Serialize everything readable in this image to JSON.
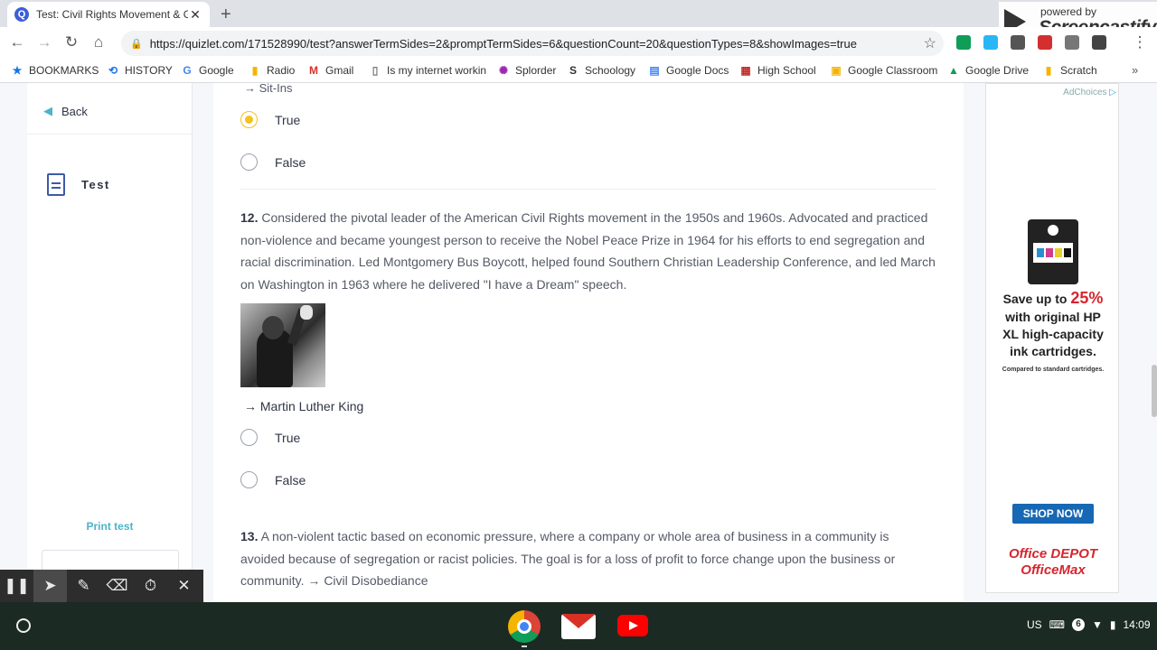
{
  "browser": {
    "tab_title": "Test: Civil Rights Movement & Gr",
    "tab_favicon": "Q",
    "url": "https://quizlet.com/171528990/test?answerTermSides=2&promptTermSides=6&questionCount=20&questionTypes=8&showImages=true",
    "bookmarks": [
      {
        "label": "BOOKMARKS",
        "icon": "star-icon",
        "color": "#1a73e8",
        "glyph": "★"
      },
      {
        "label": "HISTORY",
        "icon": "history-icon",
        "color": "#1a73e8",
        "glyph": "⟲"
      },
      {
        "label": "Google",
        "icon": "google-icon",
        "color": "#4285f4",
        "glyph": "G"
      },
      {
        "label": "Radio",
        "icon": "bookmark-icon",
        "color": "#f4b400",
        "glyph": "▮"
      },
      {
        "label": "Gmail",
        "icon": "gmail-icon",
        "color": "#d93025",
        "glyph": "M"
      },
      {
        "label": "Is my internet workin",
        "icon": "page-icon",
        "color": "#777777",
        "glyph": "▯"
      },
      {
        "label": "Splorder",
        "icon": "splorder-icon",
        "color": "#9c27b0",
        "glyph": "✺"
      },
      {
        "label": "Schoology",
        "icon": "schoology-icon",
        "color": "#333333",
        "glyph": "S"
      },
      {
        "label": "Google Docs",
        "icon": "docs-icon",
        "color": "#4285f4",
        "glyph": "▤"
      },
      {
        "label": "High School",
        "icon": "school-icon",
        "color": "#c62828",
        "glyph": "▦"
      },
      {
        "label": "Google Classroom",
        "icon": "classroom-icon",
        "color": "#f4b400",
        "glyph": "▣"
      },
      {
        "label": "Google Drive",
        "icon": "drive-icon",
        "color": "#0f9d58",
        "glyph": "▲"
      },
      {
        "label": "Scratch",
        "icon": "bookmark-icon",
        "color": "#f4b400",
        "glyph": "▮"
      }
    ],
    "more": "»"
  },
  "screencastify": {
    "small": "powered by",
    "big": "Screencastify"
  },
  "sidebar": {
    "back_label": "Back",
    "test_label": "Test",
    "print_label": "Print test"
  },
  "quiz": {
    "prev_answer": "→ Sit-Ins",
    "q11_options": [
      {
        "label": "True",
        "selected": true
      },
      {
        "label": "False",
        "selected": false
      }
    ],
    "q12": {
      "number": "12.",
      "text": "Considered the pivotal leader of the American Civil Rights movement in the 1950s and 1960s. Advocated and practiced non-violence and became youngest person to receive the Nobel Peace Prize in 1964 for his efforts to end segregation and racial discrimination. Led Montgomery Bus Boycott, helped found Southern Christian Leadership Conference, and led March on Washington in 1963 where he delivered \"I have a Dream\" speech.",
      "answer": "→ Martin Luther King",
      "options": [
        {
          "label": "True",
          "selected": false
        },
        {
          "label": "False",
          "selected": false
        }
      ]
    },
    "q13": {
      "number": "13.",
      "text": "A non-violent tactic based on economic pressure, where a company or whole area of business in a community is avoided because of segregation or racist policies. The goal is for a loss of profit to force change upon the business or community. → Civil Disobediance"
    }
  },
  "ad": {
    "adchoices": "AdChoices",
    "save_prefix": "Save up to",
    "save_pct": "25%",
    "line1": "with original HP",
    "line2": "XL high-capacity",
    "line3": "ink cartridges.",
    "small": "Compared to standard cartridges.",
    "cta": "SHOP NOW",
    "brand1": "Office DEPOT",
    "brand2": "OfficeMax"
  },
  "shelf": {
    "ime": "US",
    "notif_count": "6",
    "time": "14:09"
  }
}
